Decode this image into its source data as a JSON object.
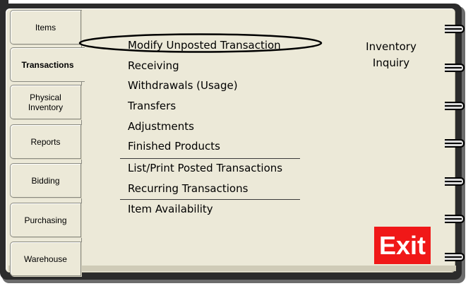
{
  "tabs": [
    {
      "label": "Items",
      "active": false
    },
    {
      "label": "Transactions",
      "active": true
    },
    {
      "label": "Physical Inventory",
      "active": false
    },
    {
      "label": "Reports",
      "active": false
    },
    {
      "label": "Bidding",
      "active": false
    },
    {
      "label": "Purchasing",
      "active": false
    },
    {
      "label": "Warehouse",
      "active": false
    }
  ],
  "menu": {
    "items": [
      "Modify Unposted Transaction",
      "Receiving",
      "Withdrawals (Usage)",
      "Transfers",
      "Adjustments",
      "Finished Products",
      "List/Print Posted Transactions",
      "Recurring Transactions",
      "Item Availability"
    ]
  },
  "side_panel": {
    "title": "Inventory Inquiry"
  },
  "exit_label": "Exit",
  "colors": {
    "page": "#ece9d8",
    "binder": "#2b2b2b",
    "exit": "#f01818"
  }
}
